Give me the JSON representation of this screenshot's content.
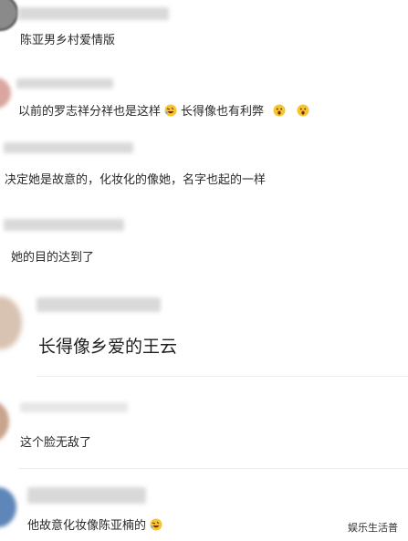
{
  "comments": [
    {
      "text": "陈亚男乡村爱情版"
    },
    {
      "text_1": "以前的罗志祥分祥也是这样",
      "emoji_1": "rofl-emoji",
      "text_2": "长得像也有利弊",
      "emoji_2": "astonished-emoji",
      "emoji_3": "astonished-emoji"
    },
    {
      "text": "决定她是故意的，化妆化的像她，名字也起的一样"
    },
    {
      "text": "她的目的达到了"
    },
    {
      "text": "长得像乡爱的王云"
    },
    {
      "text": "这个脸无敌了"
    },
    {
      "text_1": "他故意化妆像陈亚楠的",
      "emoji_1": "rofl-emoji"
    }
  ],
  "watermark": "娱乐生活普",
  "colors": {
    "background": "#ffffff",
    "text": "#2a2a2a",
    "blurred_name": "#d9d9d9",
    "emoji_face": "#f7c531"
  }
}
